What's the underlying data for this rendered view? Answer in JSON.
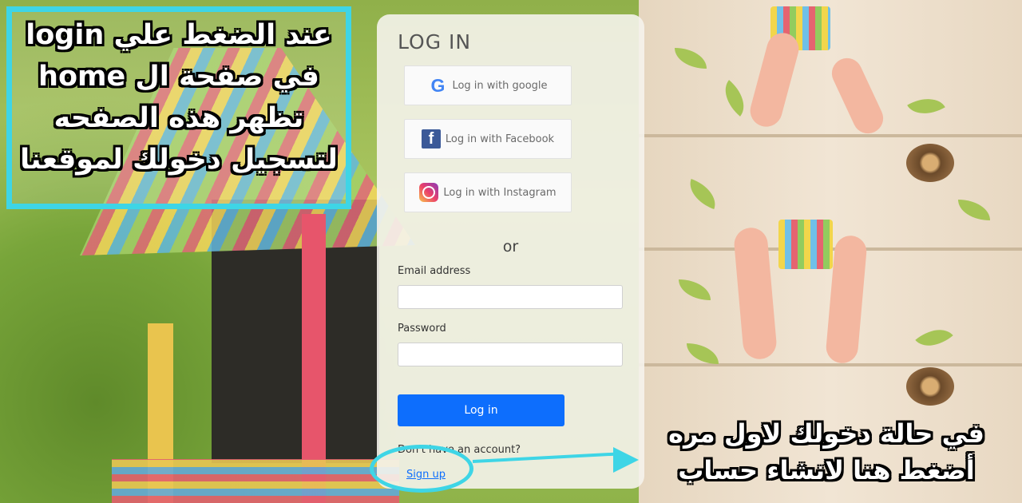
{
  "card": {
    "title": "LOG IN",
    "social": {
      "google": "Log in with google",
      "facebook": "Log in with Facebook",
      "instagram": "Log in with Instagram"
    },
    "or_label": "or",
    "email_label": "Email address",
    "email_value": "",
    "password_label": "Password",
    "password_value": "",
    "login_button": "Log in",
    "no_account_text": "Don't have an account?",
    "signup_link": "Sign up"
  },
  "annotations": {
    "top_left_lines": [
      "عند الضغط علي login",
      "في صفحة ال home",
      "تظهر هذه الصفحه",
      "لتسجيل دخولك لموقعنا"
    ],
    "bottom_right_lines": [
      "في حالة دخولك لاول مره",
      "أضغط هنا لانشاء حساب"
    ]
  },
  "icons": {
    "google": "google-icon",
    "facebook": "facebook-icon",
    "instagram": "instagram-icon",
    "arrow": "arrow-right-icon"
  },
  "colors": {
    "accent_cyan": "#3ed5e6",
    "primary_button": "#0d6efd",
    "facebook_blue": "#3b5998"
  }
}
